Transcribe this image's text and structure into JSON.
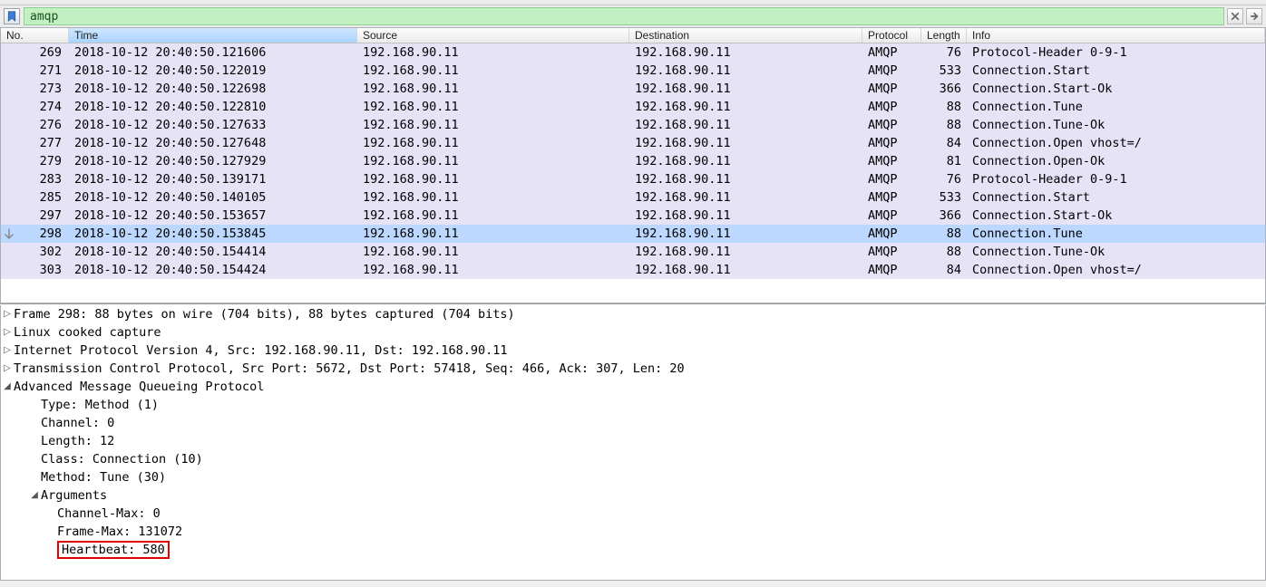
{
  "filter": {
    "value": "amqp"
  },
  "columns": {
    "no": "No.",
    "time": "Time",
    "source": "Source",
    "destination": "Destination",
    "protocol": "Protocol",
    "length": "Length",
    "info": "Info"
  },
  "packets": [
    {
      "no": "269",
      "time": "2018-10-12 20:40:50.121606",
      "src": "192.168.90.11",
      "dst": "192.168.90.11",
      "proto": "AMQP",
      "len": "76",
      "info": "Protocol-Header 0-9-1"
    },
    {
      "no": "271",
      "time": "2018-10-12 20:40:50.122019",
      "src": "192.168.90.11",
      "dst": "192.168.90.11",
      "proto": "AMQP",
      "len": "533",
      "info": "Connection.Start"
    },
    {
      "no": "273",
      "time": "2018-10-12 20:40:50.122698",
      "src": "192.168.90.11",
      "dst": "192.168.90.11",
      "proto": "AMQP",
      "len": "366",
      "info": "Connection.Start-Ok"
    },
    {
      "no": "274",
      "time": "2018-10-12 20:40:50.122810",
      "src": "192.168.90.11",
      "dst": "192.168.90.11",
      "proto": "AMQP",
      "len": "88",
      "info": "Connection.Tune"
    },
    {
      "no": "276",
      "time": "2018-10-12 20:40:50.127633",
      "src": "192.168.90.11",
      "dst": "192.168.90.11",
      "proto": "AMQP",
      "len": "88",
      "info": "Connection.Tune-Ok"
    },
    {
      "no": "277",
      "time": "2018-10-12 20:40:50.127648",
      "src": "192.168.90.11",
      "dst": "192.168.90.11",
      "proto": "AMQP",
      "len": "84",
      "info": "Connection.Open vhost=/"
    },
    {
      "no": "279",
      "time": "2018-10-12 20:40:50.127929",
      "src": "192.168.90.11",
      "dst": "192.168.90.11",
      "proto": "AMQP",
      "len": "81",
      "info": "Connection.Open-Ok"
    },
    {
      "no": "283",
      "time": "2018-10-12 20:40:50.139171",
      "src": "192.168.90.11",
      "dst": "192.168.90.11",
      "proto": "AMQP",
      "len": "76",
      "info": "Protocol-Header 0-9-1"
    },
    {
      "no": "285",
      "time": "2018-10-12 20:40:50.140105",
      "src": "192.168.90.11",
      "dst": "192.168.90.11",
      "proto": "AMQP",
      "len": "533",
      "info": "Connection.Start"
    },
    {
      "no": "297",
      "time": "2018-10-12 20:40:50.153657",
      "src": "192.168.90.11",
      "dst": "192.168.90.11",
      "proto": "AMQP",
      "len": "366",
      "info": "Connection.Start-Ok"
    },
    {
      "no": "298",
      "time": "2018-10-12 20:40:50.153845",
      "src": "192.168.90.11",
      "dst": "192.168.90.11",
      "proto": "AMQP",
      "len": "88",
      "info": "Connection.Tune",
      "selected": true
    },
    {
      "no": "302",
      "time": "2018-10-12 20:40:50.154414",
      "src": "192.168.90.11",
      "dst": "192.168.90.11",
      "proto": "AMQP",
      "len": "88",
      "info": "Connection.Tune-Ok"
    },
    {
      "no": "303",
      "time": "2018-10-12 20:40:50.154424",
      "src": "192.168.90.11",
      "dst": "192.168.90.11",
      "proto": "AMQP",
      "len": "84",
      "info": "Connection.Open vhost=/"
    }
  ],
  "details": {
    "frame": "Frame 298: 88 bytes on wire (704 bits), 88 bytes captured (704 bits)",
    "linux": "Linux cooked capture",
    "ip": "Internet Protocol Version 4, Src: 192.168.90.11, Dst: 192.168.90.11",
    "tcp": "Transmission Control Protocol, Src Port: 5672, Dst Port: 57418, Seq: 466, Ack: 307, Len: 20",
    "amqp": "Advanced Message Queueing Protocol",
    "type": "Type: Method (1)",
    "channel": "Channel: 0",
    "length": "Length: 12",
    "class": "Class: Connection (10)",
    "method": "Method: Tune (30)",
    "args": "Arguments",
    "chmax": "Channel-Max: 0",
    "frmax": "Frame-Max: 131072",
    "hb": "Heartbeat: 580"
  }
}
